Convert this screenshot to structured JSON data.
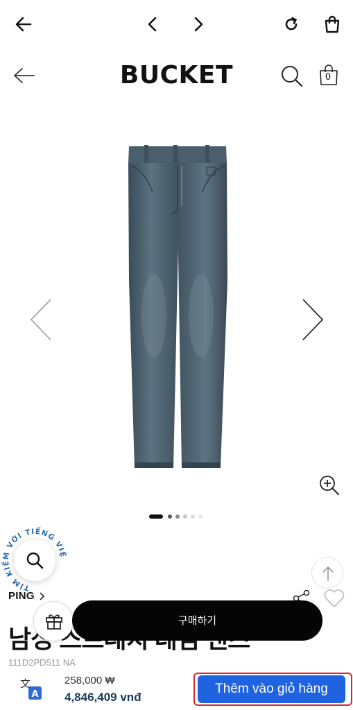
{
  "browser": {
    "back_icon": "arrow-left-icon",
    "prev_icon": "chevron-left-icon",
    "next_icon": "chevron-right-icon",
    "reload_icon": "reload-icon",
    "bag_icon": "shopping-bag-icon"
  },
  "header": {
    "logo": "BUCKET",
    "cart_count": "0"
  },
  "gallery": {
    "image_description_icon": "jeans-image",
    "total_slides": 5,
    "active_slide": 1
  },
  "floating_search": {
    "circular_text": "TÌM KIẾM VỚI TIẾNG VIỆT"
  },
  "product": {
    "brand": "PING",
    "title": "남성 스트레치 데님 팬츠",
    "code": "111D2PD511 NA"
  },
  "actions": {
    "buy_label": "구매하기"
  },
  "translation_bar": {
    "price_original": "258,000 ₩",
    "price_converted": "4,846,409 vnđ",
    "add_to_cart_label": "Thêm vào giỏ hàng"
  },
  "colors": {
    "accent_blue": "#1f63e0",
    "highlight_red": "#d9262c",
    "buy_black": "#050505"
  }
}
